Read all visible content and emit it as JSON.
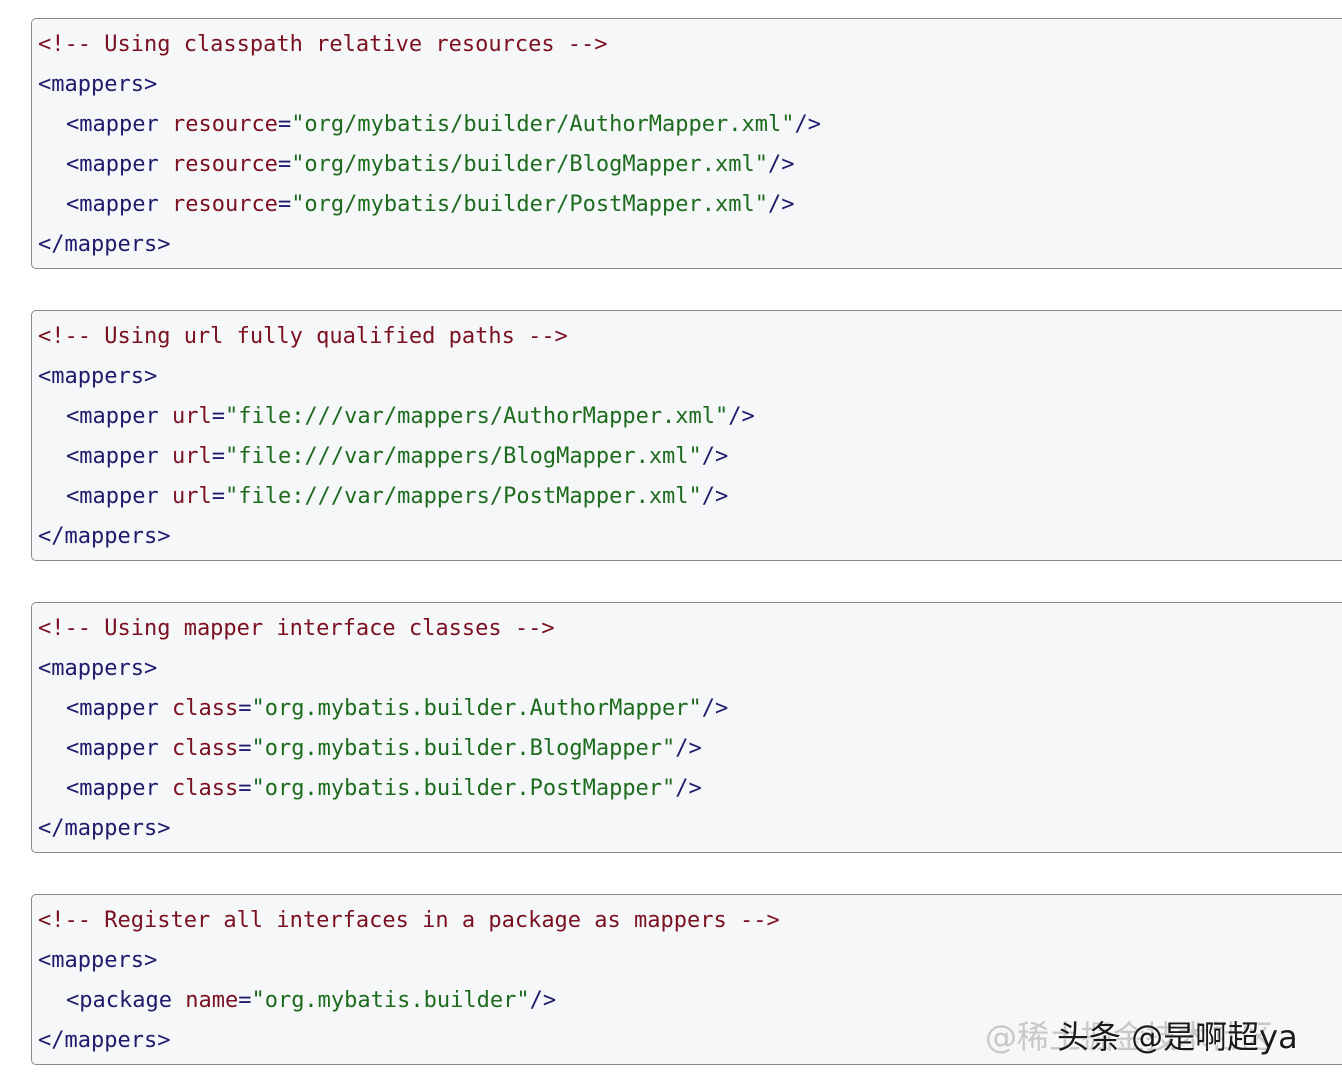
{
  "blocks": [
    {
      "comment": "<!-- Using classpath relative resources -->",
      "open": "<mappers>",
      "close": "</mappers>",
      "items": [
        {
          "tag": "<mapper",
          "attr": "resource",
          "value": "\"org/mybatis/builder/AuthorMapper.xml\"",
          "end": "/>"
        },
        {
          "tag": "<mapper",
          "attr": "resource",
          "value": "\"org/mybatis/builder/BlogMapper.xml\"",
          "end": "/>"
        },
        {
          "tag": "<mapper",
          "attr": "resource",
          "value": "\"org/mybatis/builder/PostMapper.xml\"",
          "end": "/>"
        }
      ]
    },
    {
      "comment": "<!-- Using url fully qualified paths -->",
      "open": "<mappers>",
      "close": "</mappers>",
      "items": [
        {
          "tag": "<mapper",
          "attr": "url",
          "value": "\"file:///var/mappers/AuthorMapper.xml\"",
          "end": "/>"
        },
        {
          "tag": "<mapper",
          "attr": "url",
          "value": "\"file:///var/mappers/BlogMapper.xml\"",
          "end": "/>"
        },
        {
          "tag": "<mapper",
          "attr": "url",
          "value": "\"file:///var/mappers/PostMapper.xml\"",
          "end": "/>"
        }
      ]
    },
    {
      "comment": "<!-- Using mapper interface classes -->",
      "open": "<mappers>",
      "close": "</mappers>",
      "items": [
        {
          "tag": "<mapper",
          "attr": "class",
          "value": "\"org.mybatis.builder.AuthorMapper\"",
          "end": "/>"
        },
        {
          "tag": "<mapper",
          "attr": "class",
          "value": "\"org.mybatis.builder.BlogMapper\"",
          "end": "/>"
        },
        {
          "tag": "<mapper",
          "attr": "class",
          "value": "\"org.mybatis.builder.PostMapper\"",
          "end": "/>"
        }
      ]
    },
    {
      "comment": "<!-- Register all interfaces in a package as mappers -->",
      "open": "<mappers>",
      "close": "</mappers>",
      "items": [
        {
          "tag": "<package",
          "attr": "name",
          "value": "\"org.mybatis.builder\"",
          "end": "/>"
        }
      ]
    }
  ],
  "watermark": {
    "faint": "@稀土掘金技术社区",
    "dark": "头条 @是啊超ya"
  },
  "colors": {
    "comment": "#7a1020",
    "tag": "#1d1b6b",
    "attr": "#7a1020",
    "value": "#1d6b1d",
    "block_bg": "#f6f7f9"
  }
}
